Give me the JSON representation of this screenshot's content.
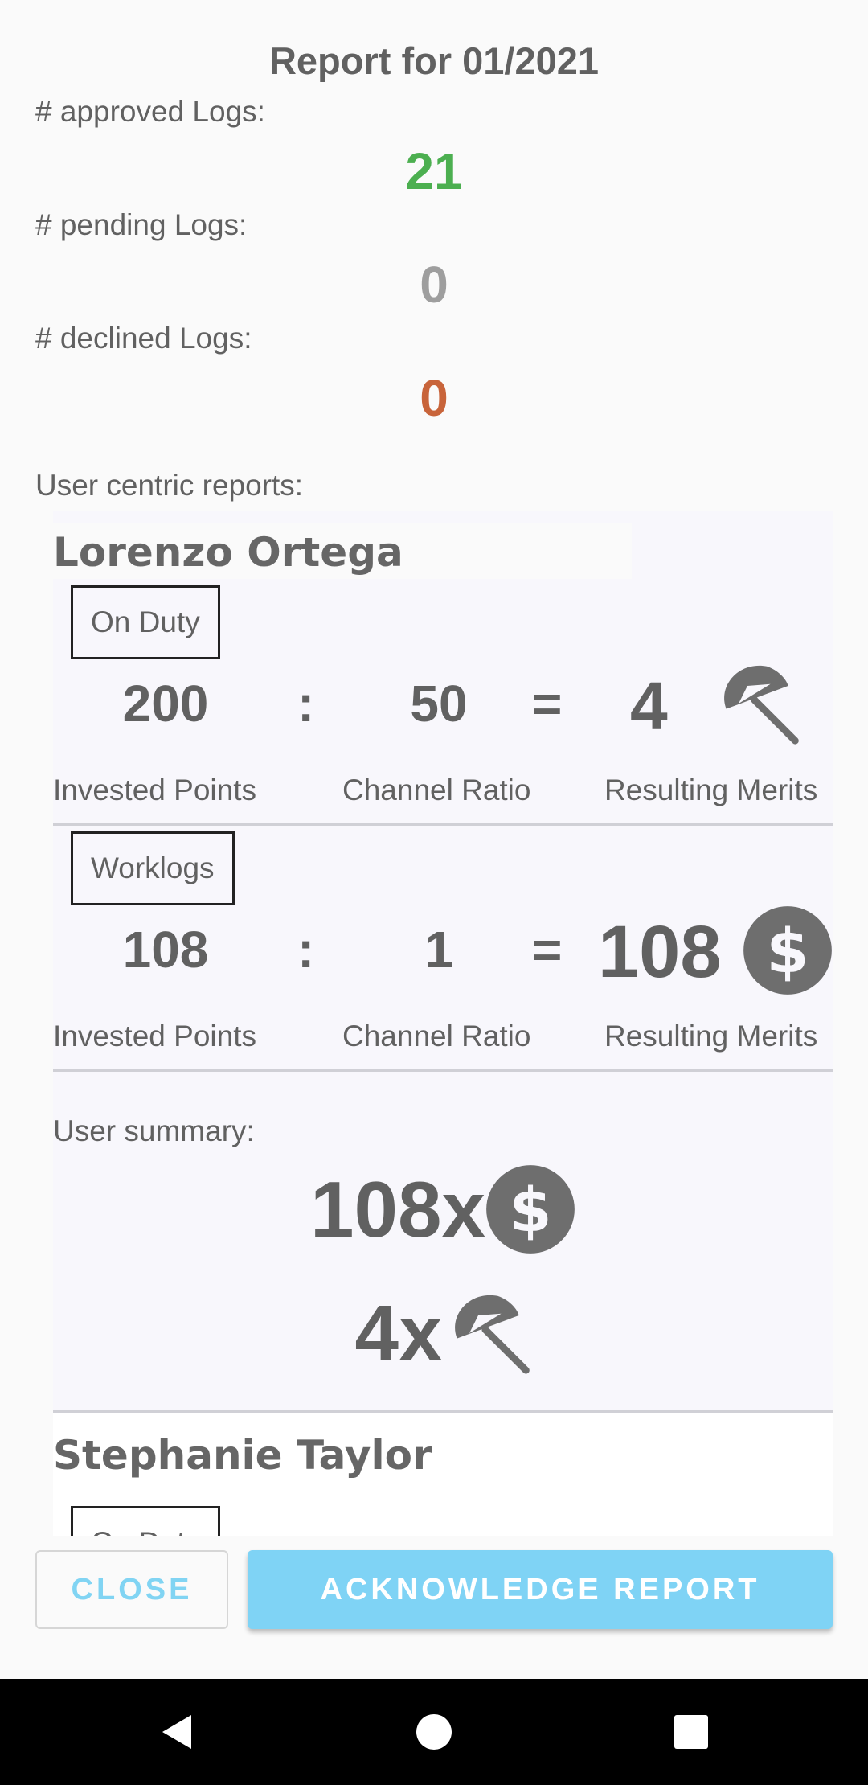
{
  "report": {
    "title": "Report for 01/2021",
    "approved_label": "# approved Logs:",
    "approved_value": "21",
    "pending_label": "# pending Logs:",
    "pending_value": "0",
    "declined_label": "# declined Logs:",
    "declined_value": "0",
    "user_centric_label": "User centric reports:"
  },
  "colors": {
    "approved": "#4caf50",
    "pending": "#9e9e9e",
    "declined": "#c8643a",
    "accent": "#7fd3f5",
    "text": "#616161"
  },
  "users": [
    {
      "name": "Lorenzo Ortega",
      "channels": [
        {
          "tag": "On Duty",
          "invested": "200",
          "ratio": "50",
          "result": "4",
          "icon": "umbrella-icon",
          "invested_caption": "Invested Points",
          "ratio_caption": "Channel Ratio",
          "result_caption": "Resulting Merits"
        },
        {
          "tag": "Worklogs",
          "invested": "108",
          "ratio": "1",
          "result": "108",
          "icon": "dollar-icon",
          "invested_caption": "Invested Points",
          "ratio_caption": "Channel Ratio",
          "result_caption": "Resulting Merits"
        }
      ],
      "summary_label": "User summary:",
      "summary": [
        {
          "value": "108x",
          "icon": "dollar-icon"
        },
        {
          "value": "4x",
          "icon": "umbrella-icon"
        }
      ]
    },
    {
      "name": "Stephanie Taylor",
      "channels": [
        {
          "tag": "On Duty"
        }
      ]
    }
  ],
  "symbols": {
    "colon": ":",
    "equals": "="
  },
  "buttons": {
    "close": "CLOSE",
    "acknowledge": "ACKNOWLEDGE REPORT"
  },
  "navbar": {
    "back_icon": "back-triangle-icon",
    "home_icon": "home-circle-icon",
    "recents_icon": "recents-square-icon"
  }
}
